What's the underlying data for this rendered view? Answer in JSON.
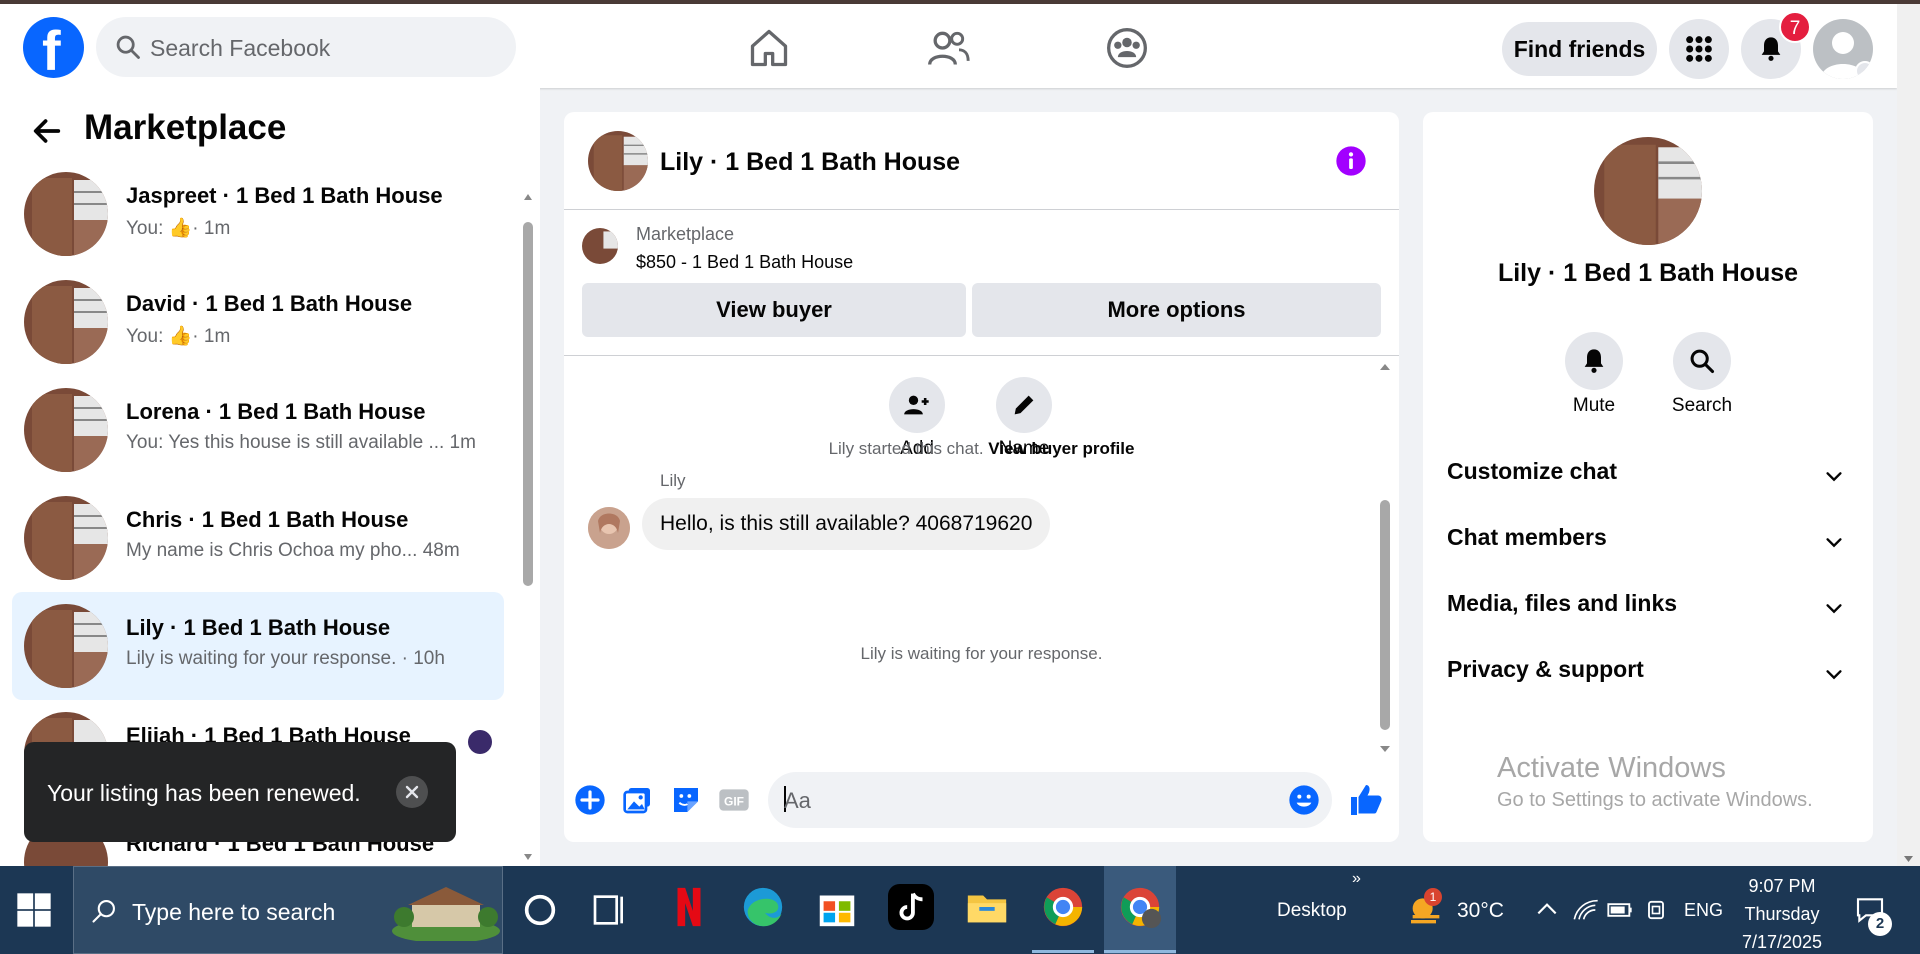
{
  "header": {
    "search_placeholder": "Search Facebook",
    "find_friends_label": "Find friends",
    "notification_count": "7"
  },
  "left": {
    "title": "Marketplace",
    "conversations": [
      {
        "name": "Jaspreet · 1 Bed 1 Bath House",
        "preview_prefix": "You:",
        "preview_time": "· 1m",
        "active": false
      },
      {
        "name": "David · 1 Bed 1 Bath House",
        "preview_prefix": "You:",
        "preview_time": "· 1m",
        "active": false
      },
      {
        "name": "Lorena · 1 Bed 1 Bath House",
        "preview": "You: Yes this house is still available ...  1m",
        "active": false
      },
      {
        "name": "Chris · 1 Bed 1 Bath House",
        "preview": "My name is Chris Ochoa my pho...   48m",
        "active": false
      },
      {
        "name": "Lily · 1 Bed 1 Bath House",
        "preview": "Lily is waiting for your response. · 10h",
        "active": true
      },
      {
        "name": "Elijah · 1 Bed 1 Bath House",
        "preview": "",
        "active": false
      },
      {
        "name": "Richard · 1 Bed 1 Bath House",
        "preview": "",
        "active": false
      }
    ],
    "toast": "Your listing has been renewed."
  },
  "chat": {
    "title": "Lily · 1 Bed 1 Bath House",
    "listing_source": "Marketplace",
    "listing_price": "$850 - 1 Bed 1 Bath House",
    "view_buyer_label": "View buyer",
    "more_options_label": "More options",
    "add_label": "Add",
    "name_label": "Name",
    "started_text": "Lily started this chat.",
    "view_profile_link": "View buyer profile",
    "sender_name": "Lily",
    "message": "Hello, is this still available? 4068719620",
    "waiting_text": "Lily is waiting for your response.",
    "composer_placeholder": "Aa"
  },
  "details": {
    "name": "Lily · 1 Bed 1 Bath House",
    "mute_label": "Mute",
    "search_label": "Search",
    "sections": [
      "Customize chat",
      "Chat members",
      "Media, files and links",
      "Privacy & support"
    ]
  },
  "watermark": {
    "line1": "Activate Windows",
    "line2": "Go to Settings to activate Windows."
  },
  "taskbar": {
    "search_placeholder": "Type here to search",
    "desktop_label": "Desktop",
    "weather": "30°C",
    "language": "ENG",
    "time": "9:07 PM",
    "day": "Thursday",
    "date": "7/17/2025",
    "notification_count": "2",
    "weather_badge": "1"
  },
  "colors": {
    "brand": "#0866ff",
    "accent_purple": "#a200ff",
    "active_row": "#e7f3ff",
    "taskbar": "#1c3754"
  }
}
